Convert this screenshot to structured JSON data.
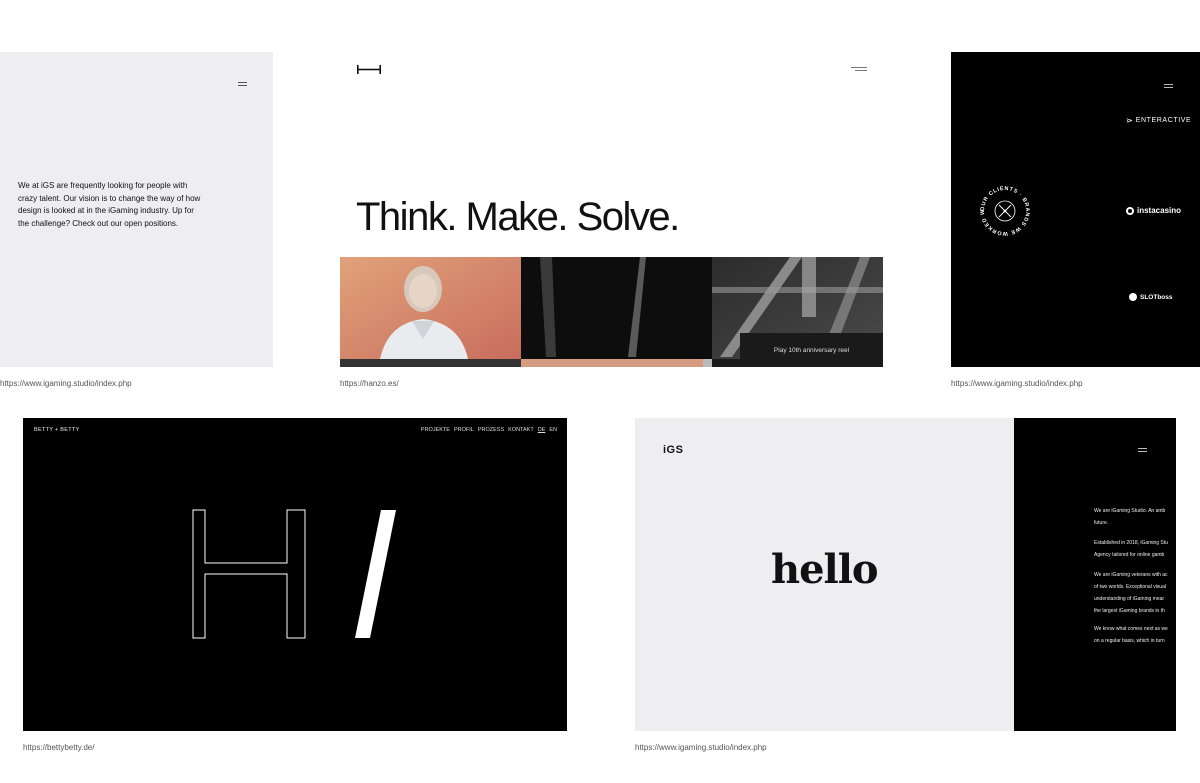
{
  "cards": [
    {
      "caption": "https://www.igaming.studio/index.php",
      "body_text": "We at iGS are frequently looking for people with crazy talent. Our vision is to change the way of how design is looked at in the iGaming industry. Up for the challenge? Check out our open positions.",
      "icon": "hamburger-menu-icon"
    },
    {
      "caption": "https://hanzo.es/",
      "headline": "Think. Make. Solve.",
      "reel_button": "Play 10th anniversary reel",
      "icon": "menu-lines-icon"
    },
    {
      "caption": "https://www.igaming.studio/index.php",
      "badge_text": "OUR CLIENTS · BRANDS WE WORKED WITH ·",
      "brands": [
        "ENTERACTIVE",
        "instacasino",
        "SLOTboss"
      ]
    },
    {
      "caption": "https://bettybetty.de/",
      "brand": "BETTY + BETTY",
      "nav": [
        "PROJEKTE",
        "PROFIL",
        "PROZESS",
        "KONTAKT",
        "DE",
        "EN"
      ],
      "active_lang": "DE"
    },
    {
      "caption": "https://www.igaming.studio/index.php",
      "logo": "iGS",
      "hello": "hello",
      "paragraphs": [
        "We are iGaming Studio. An amb",
        "future.",
        "Established in 2018, iGaming Stu",
        "Agency tailored for online gamb",
        "We are iGaming veterans with ac",
        "of two worlds. Exceptional visual",
        "understanding of iGaming mear",
        "the largest iGaming brands in th",
        "We know what comes next as we",
        "on a regular basis, which in turn"
      ]
    }
  ],
  "colors": {
    "light_panel": "#eeedf0",
    "dark": "#000000",
    "reel_button": "#1a1a1a"
  }
}
